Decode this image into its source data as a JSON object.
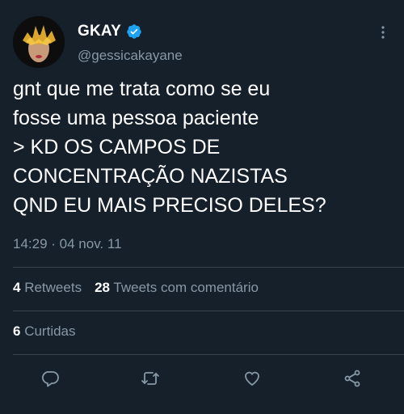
{
  "author": {
    "name": "GKAY",
    "handle": "@gessicakayane",
    "verified": true
  },
  "tweet": {
    "text": "gnt que me trata como se eu\nfosse uma pessoa paciente\n> KD OS CAMPOS DE\nCONCENTRAÇÃO NAZISTAS\nQND EU MAIS PRECISO DELES?",
    "timestamp": "14:29 · 04 nov. 11"
  },
  "stats": {
    "retweets_count": "4",
    "retweets_label": "Retweets",
    "quotes_count": "28",
    "quotes_label": "Tweets com comentário",
    "likes_count": "6",
    "likes_label": "Curtidas"
  },
  "actions": {
    "reply_icon": "reply-icon",
    "retweet_icon": "retweet-icon",
    "like_icon": "heart-icon",
    "share_icon": "share-icon"
  },
  "colors": {
    "background": "#15202b",
    "secondary_text": "#8899a6",
    "verified": "#1da1f2",
    "divider": "#38444d"
  }
}
